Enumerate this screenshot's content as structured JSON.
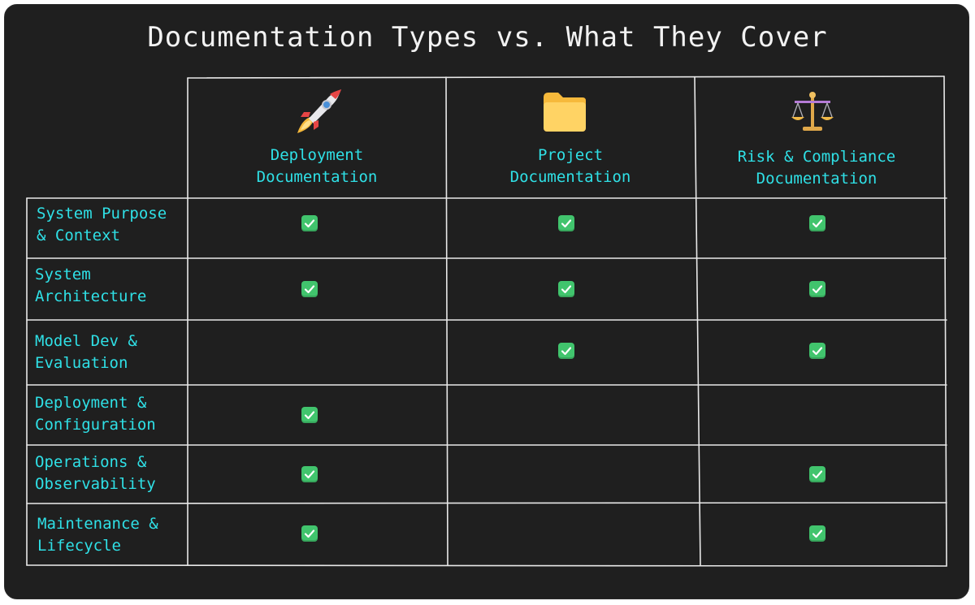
{
  "title": "Documentation Types vs. What They Cover",
  "columns": [
    {
      "label_line1": "Deployment",
      "label_line2": "Documentation",
      "icon": "rocket-icon"
    },
    {
      "label_line1": "Project",
      "label_line2": "Documentation",
      "icon": "folder-icon"
    },
    {
      "label_line1": "Risk & Compliance",
      "label_line2": "Documentation",
      "icon": "balance-scale-icon"
    }
  ],
  "rows": [
    {
      "label_line1": "System Purpose",
      "label_line2": "& Context",
      "checks": [
        true,
        true,
        true
      ]
    },
    {
      "label_line1": "System",
      "label_line2": "Architecture",
      "checks": [
        true,
        true,
        true
      ]
    },
    {
      "label_line1": "Model Dev &",
      "label_line2": "Evaluation",
      "checks": [
        false,
        true,
        true
      ]
    },
    {
      "label_line1": "Deployment &",
      "label_line2": "Configuration",
      "checks": [
        true,
        false,
        false
      ]
    },
    {
      "label_line1": "Operations &",
      "label_line2": "Observability",
      "checks": [
        true,
        false,
        true
      ]
    },
    {
      "label_line1": "Maintenance &",
      "label_line2": "Lifecycle",
      "checks": [
        true,
        false,
        true
      ]
    }
  ],
  "colors": {
    "background": "#1f1f1f",
    "text_accent": "#2fe0e6",
    "title": "#f2f2f2",
    "check": "#41c46d",
    "grid": "#e8e8e8"
  }
}
